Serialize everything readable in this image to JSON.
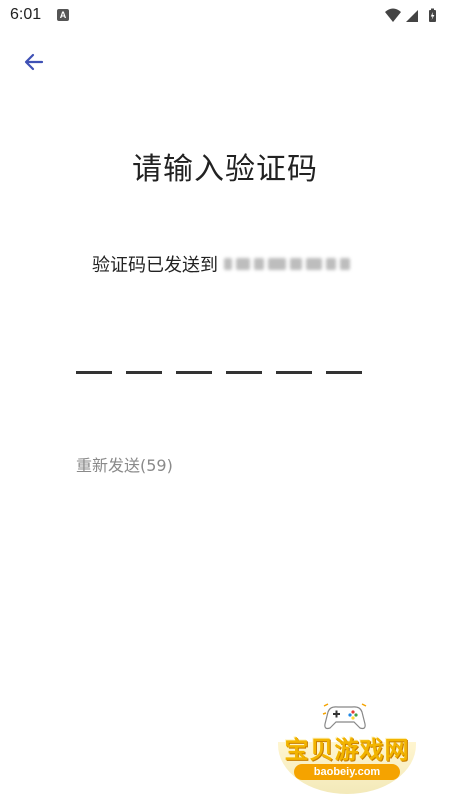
{
  "status_bar": {
    "time": "6:01",
    "notification_icon": "A",
    "icons": [
      "wifi-icon",
      "signal-icon",
      "battery-icon"
    ]
  },
  "header": {
    "back_icon": "arrow-left-icon"
  },
  "main": {
    "title": "请输入验证码",
    "sent_to_label": "验证码已发送到",
    "phone_masked": true,
    "code_length": 6,
    "code_digits": [
      "",
      "",
      "",
      "",
      "",
      ""
    ],
    "resend_label": "重新发送(59)"
  },
  "watermark": {
    "title": "宝贝游戏网",
    "url": "baobeiy.com"
  },
  "colors": {
    "accent": "#3f51b5",
    "text": "#222222",
    "muted": "#8a8a8a",
    "underline": "#333333",
    "watermark": "#f2b400"
  }
}
